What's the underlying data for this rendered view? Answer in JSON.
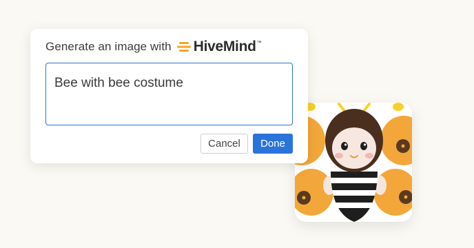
{
  "dialog": {
    "header_text": "Generate an image with",
    "brand_name": "HiveMind",
    "brand_tm": "™",
    "brand_icon": "honeycomb-stripes-icon",
    "prompt_value": "Bee with bee costume",
    "cancel_label": "Cancel",
    "done_label": "Done"
  },
  "colors": {
    "accent": "#2a74d9",
    "input_border": "#2c73c4",
    "brand_orange": "#f5a623",
    "background": "#fbf9f4"
  },
  "generated_image": {
    "subject": "bee-in-costume-illustration"
  }
}
